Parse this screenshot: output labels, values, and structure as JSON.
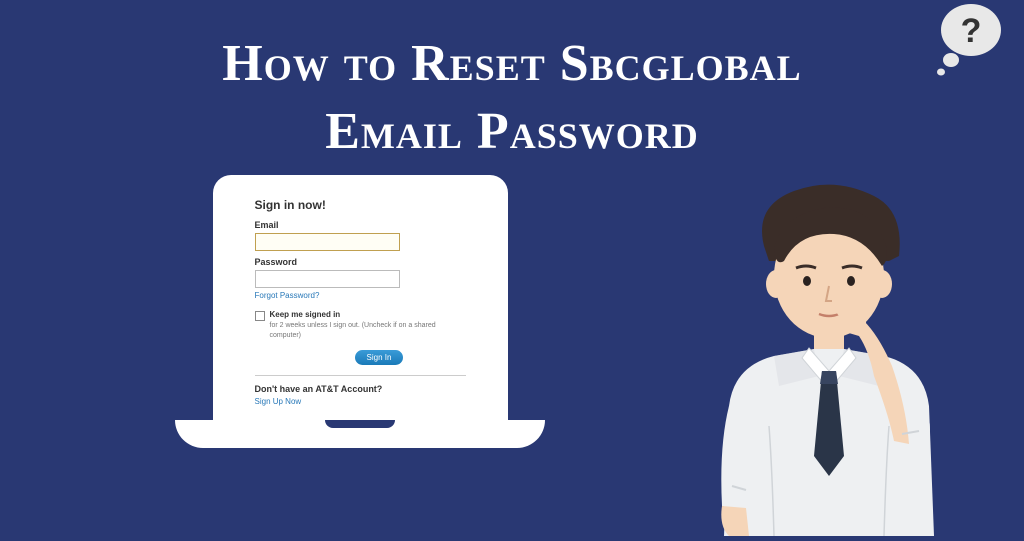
{
  "title_line1": "How to Reset Sbcglobal",
  "title_line2": "Email Password",
  "login": {
    "heading": "Sign in now!",
    "email_label": "Email",
    "password_label": "Password",
    "forgot_password": "Forgot Password?",
    "keep_signed_label": "Keep me signed in",
    "keep_signed_sub": "for 2 weeks unless I sign out. (Uncheck if on a shared computer)",
    "signin_button": "Sign In",
    "no_account": "Don't have an AT&T Account?",
    "signup_link": "Sign Up Now"
  },
  "thought_symbol": "?",
  "colors": {
    "background": "#293873",
    "title_text": "#ffffff",
    "link_color": "#2878b8",
    "button_color": "#2a8ac8"
  }
}
